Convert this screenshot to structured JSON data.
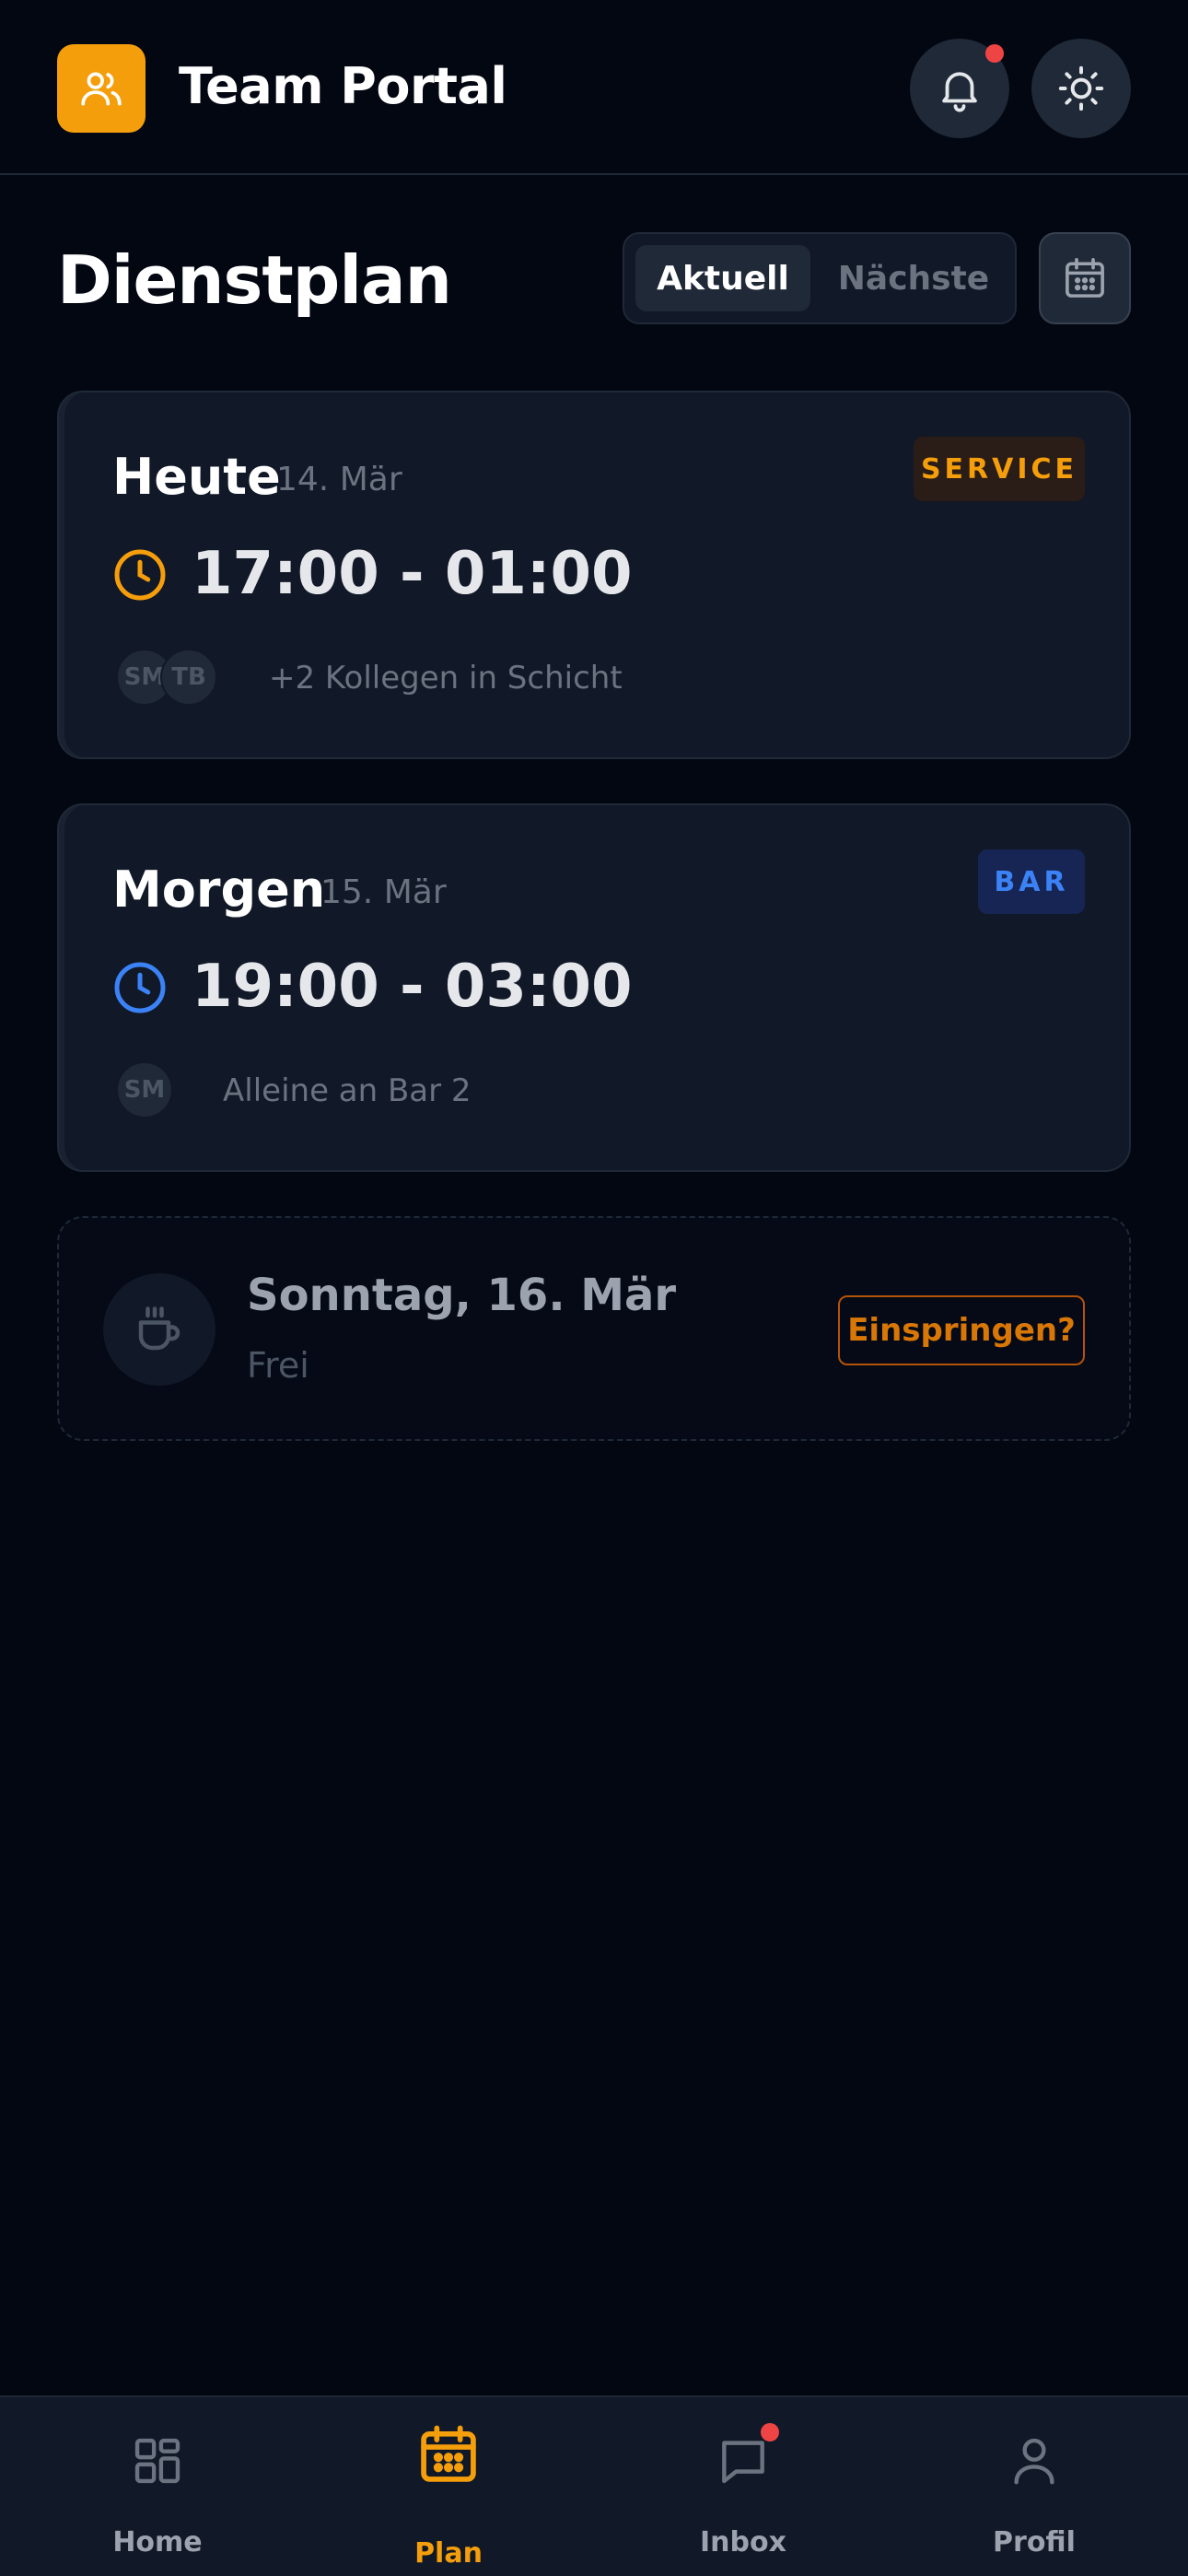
{
  "header": {
    "app_title": "Team Portal",
    "logo_icon": "users-icon",
    "notifications_icon": "bell-icon",
    "theme_icon": "sun-icon",
    "has_unread_notifications": true
  },
  "schedule": {
    "title": "Dienstplan",
    "tabs": [
      {
        "label": "Aktuell",
        "active": true
      },
      {
        "label": "Nächste",
        "active": false
      }
    ],
    "calendar_icon": "calendar-icon"
  },
  "shifts": [
    {
      "day": "Heute",
      "date": "14. Mär",
      "badge": "SERVICE",
      "time": "17:00 - 01:00",
      "accent_color": "#f59e0b",
      "avatars": [
        "SM",
        "TB"
      ],
      "note": "+2 Kollegen in Schicht"
    },
    {
      "day": "Morgen",
      "date": "15. Mär",
      "badge": "BAR",
      "time": "19:00 - 03:00",
      "accent_color": "#3b82f6",
      "avatars": [
        "SM"
      ],
      "note": "Alleine an Bar 2"
    }
  ],
  "free_day": {
    "title": "Sonntag, 16. Mär",
    "status": "Frei",
    "icon": "coffee-icon",
    "action_label": "Einspringen?"
  },
  "bottom_nav": [
    {
      "label": "Home",
      "icon": "grid-icon",
      "active": false
    },
    {
      "label": "Plan",
      "icon": "calendar-icon",
      "active": true
    },
    {
      "label": "Inbox",
      "icon": "message-icon",
      "active": false,
      "has_badge": true
    },
    {
      "label": "Profil",
      "icon": "user-icon",
      "active": false
    }
  ],
  "colors": {
    "background": "#030712",
    "surface": "#111827",
    "accent": "#f59e0b",
    "bar_blue": "#3b82f6",
    "alert": "#ef4444"
  }
}
